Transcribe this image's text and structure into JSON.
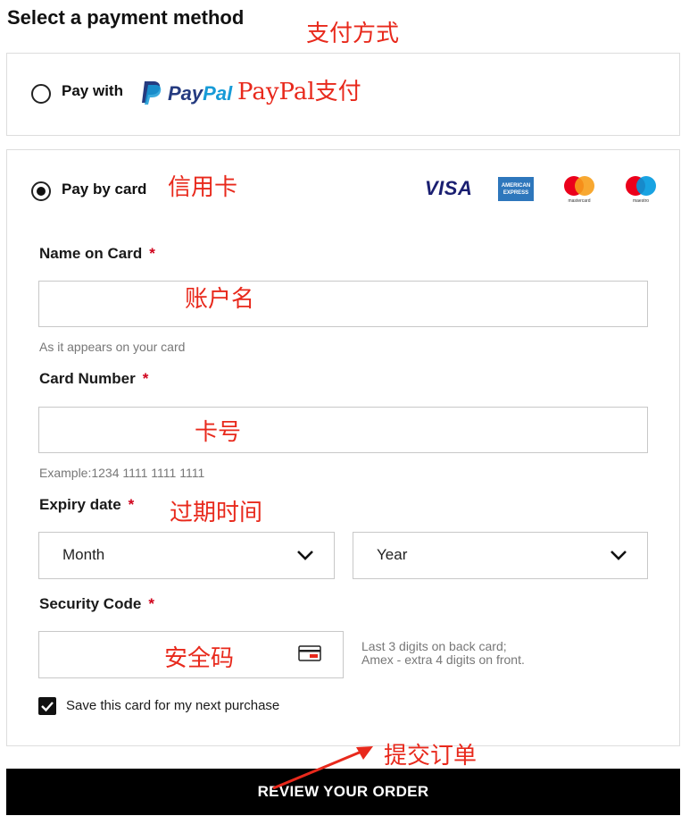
{
  "page": {
    "title": "Select a payment method",
    "title_annotation": "支付方式"
  },
  "paypal_option": {
    "label": "Pay with",
    "brand_pay": "Pay",
    "brand_pal": "Pal",
    "annotation": "PayPal支付",
    "selected": false
  },
  "card_option": {
    "label": "Pay by card",
    "annotation": "信用卡",
    "selected": true,
    "brands": {
      "visa": "VISA",
      "amex_line1": "AMERICAN",
      "amex_line2": "EXPRESS",
      "mastercard": "mastercard",
      "maestro": "maestro"
    }
  },
  "form": {
    "required_mark": "*",
    "name": {
      "label": "Name on Card",
      "value": "",
      "annotation": "账户名",
      "hint": "As it appears on your card"
    },
    "number": {
      "label": "Card Number",
      "value": "",
      "annotation": "卡号",
      "hint": "Example:1234 1111 1111 1111"
    },
    "expiry": {
      "label": "Expiry date",
      "annotation": "过期时间",
      "month": "Month",
      "year": "Year"
    },
    "security": {
      "label": "Security Code",
      "value": "",
      "annotation": "安全码",
      "hint_line1": "Last 3 digits on back card;",
      "hint_line2": "Amex - extra 4 digits on front."
    },
    "save_card": {
      "label": "Save this card for my next purchase",
      "checked": true
    }
  },
  "review": {
    "button_label": "REVIEW YOUR ORDER",
    "annotation": "提交订单"
  },
  "colors": {
    "annotation": "#e8291c",
    "required": "#d0021b",
    "button_bg": "#000000",
    "paypal_dark": "#253b80",
    "paypal_light": "#179bd7"
  }
}
